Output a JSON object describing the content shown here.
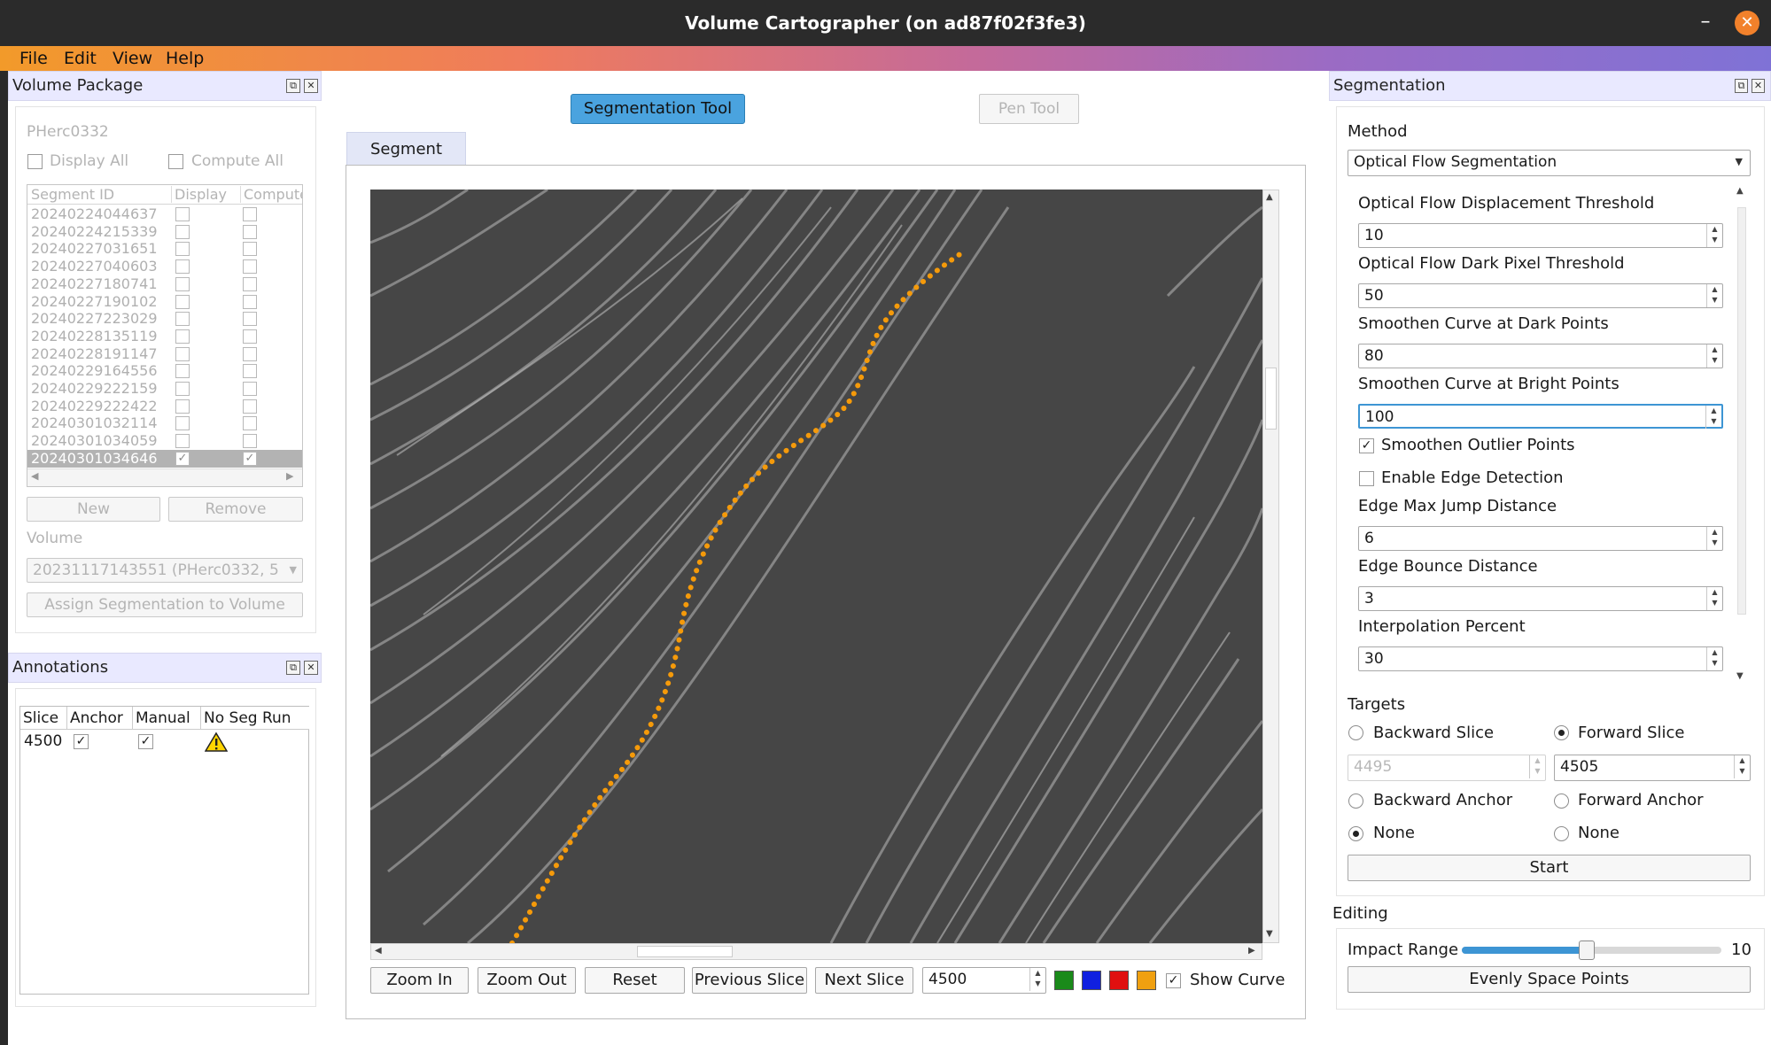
{
  "window": {
    "title": "Volume Cartographer (on ad87f02f3fe3)",
    "minimize_glyph": "–",
    "close_glyph": "✕"
  },
  "menu": [
    "File",
    "Edit",
    "View",
    "Help"
  ],
  "volume_package": {
    "title": "Volume Package",
    "package_name": "PHerc0332",
    "display_all": "Display All",
    "compute_all": "Compute All",
    "columns": [
      "Segment ID",
      "Display",
      "Compute"
    ],
    "segments": [
      {
        "id": "20240224044637",
        "display": false,
        "compute": false
      },
      {
        "id": "20240224215339",
        "display": false,
        "compute": false
      },
      {
        "id": "20240227031651",
        "display": false,
        "compute": false
      },
      {
        "id": "20240227040603",
        "display": false,
        "compute": false
      },
      {
        "id": "20240227180741",
        "display": false,
        "compute": false
      },
      {
        "id": "20240227190102",
        "display": false,
        "compute": false
      },
      {
        "id": "20240227223029",
        "display": false,
        "compute": false
      },
      {
        "id": "20240228135119",
        "display": false,
        "compute": false
      },
      {
        "id": "20240228191147",
        "display": false,
        "compute": false
      },
      {
        "id": "20240229164556",
        "display": false,
        "compute": false
      },
      {
        "id": "20240229222159",
        "display": false,
        "compute": false
      },
      {
        "id": "20240229222422",
        "display": false,
        "compute": false
      },
      {
        "id": "20240301032114",
        "display": false,
        "compute": false
      },
      {
        "id": "20240301034059",
        "display": false,
        "compute": false
      },
      {
        "id": "20240301034646",
        "display": true,
        "compute": true,
        "selected": true
      }
    ],
    "new_label": "New",
    "remove_label": "Remove",
    "volume_label": "Volume",
    "volume_value": "20231117143551 (PHerc0332, 5",
    "assign_label": "Assign Segmentation to Volume"
  },
  "annotations": {
    "title": "Annotations",
    "columns": [
      "Slice",
      "Anchor",
      "Manual",
      "No Seg Run"
    ],
    "rows": [
      {
        "slice": "4500",
        "anchor": true,
        "manual": true,
        "no_seg_run": "warning-icon"
      }
    ]
  },
  "center": {
    "segmentation_tool": "Segmentation Tool",
    "pen_tool": "Pen Tool",
    "tab": "Segment",
    "zoom_in": "Zoom In",
    "zoom_out": "Zoom Out",
    "reset": "Reset",
    "previous_slice": "Previous Slice",
    "next_slice": "Next Slice",
    "slice_value": "4500",
    "swatches": [
      "#1a8a1a",
      "#1020e0",
      "#e01010",
      "#f0a010"
    ],
    "show_curve": "Show Curve",
    "curve_color": "#f59a0a"
  },
  "segmentation": {
    "title": "Segmentation",
    "method_label": "Method",
    "method_value": "Optical Flow Segmentation",
    "params": [
      {
        "label": "Optical Flow Displacement Threshold",
        "value": "10"
      },
      {
        "label": "Optical Flow Dark Pixel Threshold",
        "value": "50"
      },
      {
        "label": "Smoothen Curve at Dark Points",
        "value": "80"
      },
      {
        "label": "Smoothen Curve at Bright Points",
        "value": "100"
      }
    ],
    "smoothen_outlier": "Smoothen Outlier Points",
    "enable_edge": "Enable Edge Detection",
    "params2": [
      {
        "label": "Edge Max Jump Distance",
        "value": "6"
      },
      {
        "label": "Edge Bounce Distance",
        "value": "3"
      },
      {
        "label": "Interpolation Percent",
        "value": "30"
      }
    ],
    "targets_label": "Targets",
    "backward_slice": "Backward Slice",
    "forward_slice": "Forward Slice",
    "backward_value": "4495",
    "forward_value": "4505",
    "backward_anchor": "Backward Anchor",
    "forward_anchor": "Forward Anchor",
    "none": "None",
    "start": "Start",
    "editing_label": "Editing",
    "impact_label": "Impact Range",
    "impact_value": "10",
    "impact_fraction": 0.48,
    "evenly_space": "Evenly Space Points"
  }
}
